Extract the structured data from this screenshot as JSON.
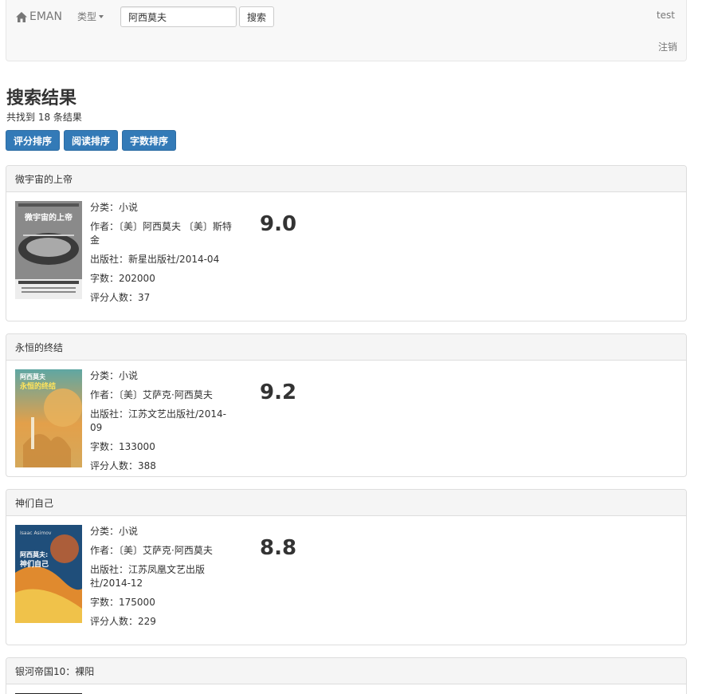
{
  "nav": {
    "brand": "EMAN",
    "category_dropdown": "类型",
    "search_value": "阿西莫夫",
    "search_button": "搜索",
    "user": "test",
    "logout": "注销"
  },
  "header": {
    "title": "搜索结果",
    "count": "共找到 18 条结果"
  },
  "sort_buttons": [
    "评分排序",
    "阅读排序",
    "字数排序"
  ],
  "labels": {
    "category": "分类：",
    "author": "作者：",
    "publisher": "出版社：",
    "words": "字数：",
    "raters": "评分人数："
  },
  "books": [
    {
      "title": "微宇宙的上帝",
      "category": "小说",
      "author": "〔美〕阿西莫夫 〔美〕斯特金",
      "publisher": "新星出版社/2014-04",
      "words": "202000",
      "raters": "37",
      "score": "9.0",
      "cover_text": "微宇宙的上帝"
    },
    {
      "title": "永恒的终结",
      "category": "小说",
      "author": "〔美〕艾萨克·阿西莫夫",
      "publisher": "江苏文艺出版社/2014-09",
      "words": "133000",
      "raters": "388",
      "score": "9.2",
      "cover_text": "永恒的终结"
    },
    {
      "title": "神们自己",
      "category": "小说",
      "author": "〔美〕艾萨克·阿西莫夫",
      "publisher": "江苏凤凰文艺出版社/2014-12",
      "words": "175000",
      "raters": "229",
      "score": "8.8",
      "cover_text": "神们自己"
    },
    {
      "title": "银河帝国10：裸阳"
    }
  ],
  "colors": {
    "primary": "#337ab7",
    "navbar_bg": "#f8f8f8",
    "panel_heading_bg": "#f5f5f5"
  }
}
